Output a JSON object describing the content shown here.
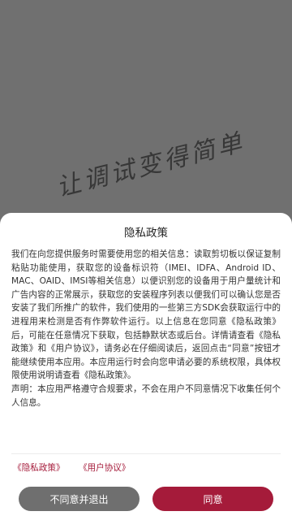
{
  "background": {
    "logo_text": "让调试变得简单"
  },
  "dialog": {
    "title": "隐私政策",
    "body": [
      "我们在向您提供服务时需要使用您的相关信息：读取剪切板以保证复制粘贴功能使用，获取您的设备标识符（IMEI、IDFA、Android ID、MAC、OAID、IMSI等相关信息）以便识别您的设备用于用户量统计和广告内容的正常展示，获取您的安装程序列表以便我们可以确认您是否安装了我们所推广的软件，我们使用的一些第三方SDK会获取运行中的进程用来检测是否有作弊软件运行。以上信息在您同意《隐私政策》后，可能在任意情况下获取，包括静默状态或后台。详情请查看《隐私政策》和《用户协议》，请务必在仔细阅读后，返回点击“同意”按钮才能继续使用本应用。本应用运行时会向您申请必要的系统权限，具体权限使用说明请查看《隐私政策》。",
      "声明：本应用严格遵守合规要求，不会在用户不同意情况下收集任何个人信息。"
    ],
    "links": {
      "privacy": "《隐私政策》",
      "terms": "《用户协议》"
    },
    "buttons": {
      "decline": "不同意并退出",
      "agree": "同意"
    }
  },
  "colors": {
    "accent": "#a51b3a",
    "decline": "#6f6f6f",
    "backdrop": "#707070"
  }
}
